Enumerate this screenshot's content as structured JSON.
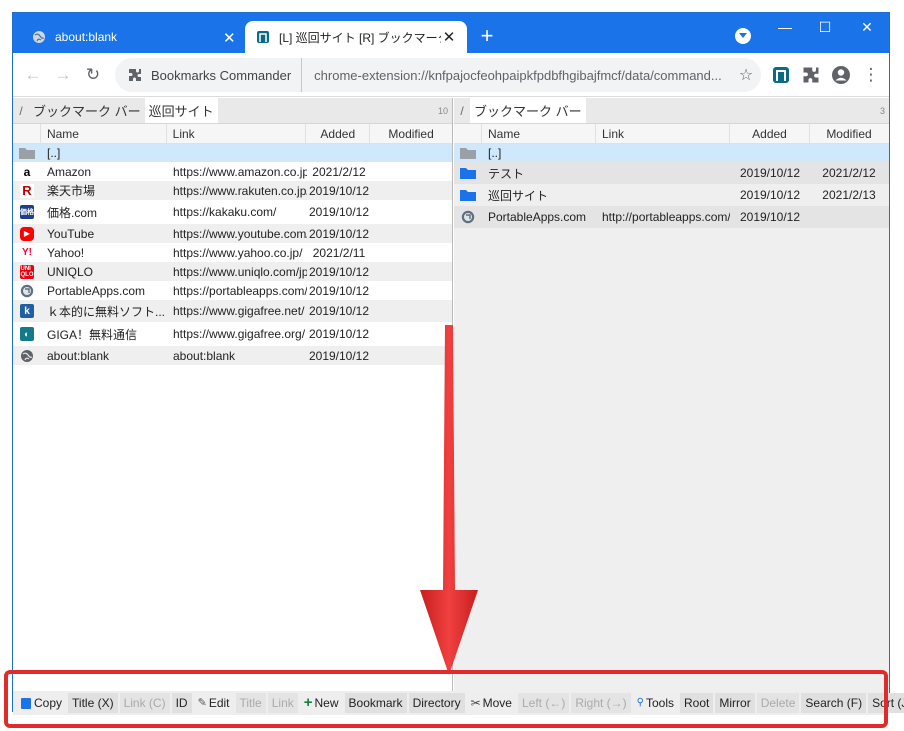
{
  "browser": {
    "tabs": [
      {
        "title": "about:blank",
        "active": false
      },
      {
        "title": "[L] 巡回サイト [R] ブックマーク バー",
        "active": true
      }
    ],
    "new_tab_label": "+",
    "window_controls": {
      "minimize": "—",
      "maximize": "☐",
      "close": "✕"
    },
    "omnibox": {
      "chip_label": "Bookmarks Commander",
      "url": "chrome-extension://knfpajocfeohpaipkfpdbfhgibajfmcf/data/command..."
    },
    "accent_color": "#1a73e8"
  },
  "left_pane": {
    "crumb_slash": "/",
    "crumbs": [
      "ブックマーク バー",
      "巡回サイト"
    ],
    "count": "10",
    "columns": {
      "name": "Name",
      "link": "Link",
      "added": "Added",
      "modified": "Modified"
    },
    "rows": [
      {
        "icon": "folder-icon",
        "name": "[..]",
        "link": "",
        "added": "",
        "modified": ""
      },
      {
        "icon": "amazon-icon",
        "name": "Amazon",
        "link": "https://www.amazon.co.jp/",
        "added": "2021/2/12",
        "modified": ""
      },
      {
        "icon": "rakuten-icon",
        "name": "楽天市場",
        "link": "https://www.rakuten.co.jp/",
        "added": "2019/10/12",
        "modified": ""
      },
      {
        "icon": "kakaku-icon",
        "name": "価格.com",
        "link": "https://kakaku.com/",
        "added": "2019/10/12",
        "modified": ""
      },
      {
        "icon": "youtube-icon",
        "name": "YouTube",
        "link": "https://www.youtube.com/",
        "added": "2019/10/12",
        "modified": ""
      },
      {
        "icon": "yahoo-icon",
        "name": "Yahoo!",
        "link": "https://www.yahoo.co.jp/",
        "added": "2021/2/11",
        "modified": ""
      },
      {
        "icon": "uniqlo-icon",
        "name": "UNIQLO",
        "link": "https://www.uniqlo.com/jp/",
        "added": "2019/10/12",
        "modified": ""
      },
      {
        "icon": "portableapps-icon",
        "name": "PortableApps.com",
        "link": "https://portableapps.com/",
        "added": "2019/10/12",
        "modified": ""
      },
      {
        "icon": "gigafree-icon",
        "name": "ｋ本的に無料ソフト...",
        "link": "https://www.gigafree.net/",
        "added": "2019/10/12",
        "modified": ""
      },
      {
        "icon": "gigafree-org-icon",
        "name": "GIGA！無料通信",
        "link": "https://www.gigafree.org/",
        "added": "2019/10/12",
        "modified": ""
      },
      {
        "icon": "globe-icon",
        "name": "about:blank",
        "link": "about:blank",
        "added": "2019/10/12",
        "modified": ""
      }
    ]
  },
  "right_pane": {
    "crumb_slash": "/",
    "crumbs": [
      "ブックマーク バー"
    ],
    "count": "3",
    "columns": {
      "name": "Name",
      "link": "Link",
      "added": "Added",
      "modified": "Modified"
    },
    "rows": [
      {
        "icon": "folder-icon",
        "name": "[..]",
        "link": "",
        "added": "",
        "modified": ""
      },
      {
        "icon": "folder-icon",
        "name": "テスト",
        "link": "",
        "added": "2019/10/12",
        "modified": "2021/2/12"
      },
      {
        "icon": "folder-icon",
        "name": "巡回サイト",
        "link": "",
        "added": "2019/10/12",
        "modified": "2021/2/13"
      },
      {
        "icon": "portableapps-icon",
        "name": "PortableApps.com",
        "link": "http://portableapps.com/",
        "added": "2019/10/12",
        "modified": ""
      }
    ]
  },
  "commands": [
    {
      "label": "Copy",
      "icon": "copy-icon",
      "kind": "label"
    },
    {
      "label": "Title (X)",
      "kind": "btn",
      "underline": "X"
    },
    {
      "label": "Link (C)",
      "kind": "dis"
    },
    {
      "label": "ID",
      "kind": "btn"
    },
    {
      "label": "Edit",
      "icon": "pencil-icon",
      "kind": "label"
    },
    {
      "label": "Title",
      "kind": "dis"
    },
    {
      "label": "Link",
      "kind": "dis"
    },
    {
      "label": "New",
      "icon": "plus-icon",
      "kind": "label"
    },
    {
      "label": "Bookmark",
      "kind": "btn"
    },
    {
      "label": "Directory",
      "kind": "btn"
    },
    {
      "label": "Move",
      "icon": "scissors-icon",
      "kind": "label"
    },
    {
      "label": "Left (←)",
      "kind": "dis"
    },
    {
      "label": "Right (→)",
      "kind": "dis"
    },
    {
      "label": "Tools",
      "icon": "tools-icon",
      "kind": "label"
    },
    {
      "label": "Root",
      "kind": "btn"
    },
    {
      "label": "Mirror",
      "kind": "btn"
    },
    {
      "label": "Delete",
      "kind": "dis"
    },
    {
      "label": "Search (F)",
      "kind": "btn"
    },
    {
      "label": "Sort (J)",
      "kind": "btn"
    }
  ],
  "highlight_color": "#e02b2b"
}
